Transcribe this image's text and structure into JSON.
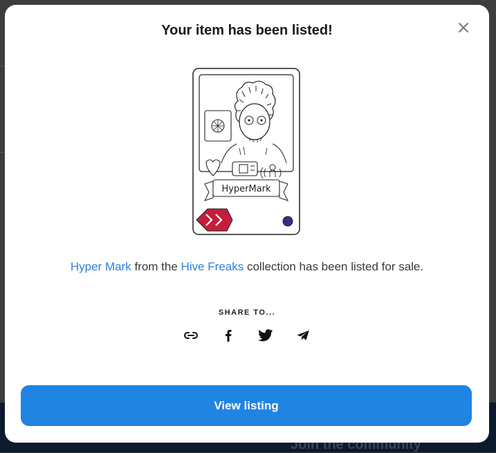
{
  "modal": {
    "title": "Your item has been listed!",
    "close_icon": "close-icon"
  },
  "listing": {
    "item_name": "Hyper Mark",
    "connector": " from the ",
    "collection_name": "Hive Freaks",
    "suffix": " collection has been listed for sale.",
    "card_caption": "HyperMark"
  },
  "share": {
    "label": "SHARE TO...",
    "targets": [
      "link-icon",
      "facebook-icon",
      "twitter-icon",
      "telegram-icon"
    ]
  },
  "cta": {
    "label": "View listing"
  },
  "background": {
    "footer_text": "Join the community"
  },
  "colors": {
    "link": "#2d7fd7",
    "button": "#2084e3",
    "card_badge": "#c41e3a",
    "card_dot": "#3a2a8a"
  }
}
